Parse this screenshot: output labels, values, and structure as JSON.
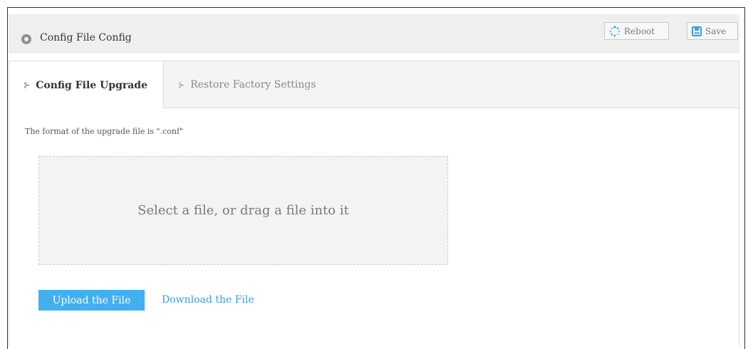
{
  "header": {
    "title": "Config File Config",
    "icon": "location-pin-icon",
    "reboot_label": "Reboot",
    "reboot_icon": "spinner-icon",
    "save_label": "Save",
    "save_icon": "floppy-disk-icon"
  },
  "tabs": [
    {
      "label": "Config File Upgrade",
      "active": true
    },
    {
      "label": "Restore Factory Settings",
      "active": false
    }
  ],
  "upgrade": {
    "format_note": "The format of the upgrade file is \".conf\"",
    "drop_zone_text": "Select a file, or drag a file into it",
    "upload_label": "Upload the File",
    "download_label": "Download the File"
  },
  "colors": {
    "accent": "#42b0ef",
    "link": "#3a9fdb",
    "header_bg": "#efefef"
  }
}
